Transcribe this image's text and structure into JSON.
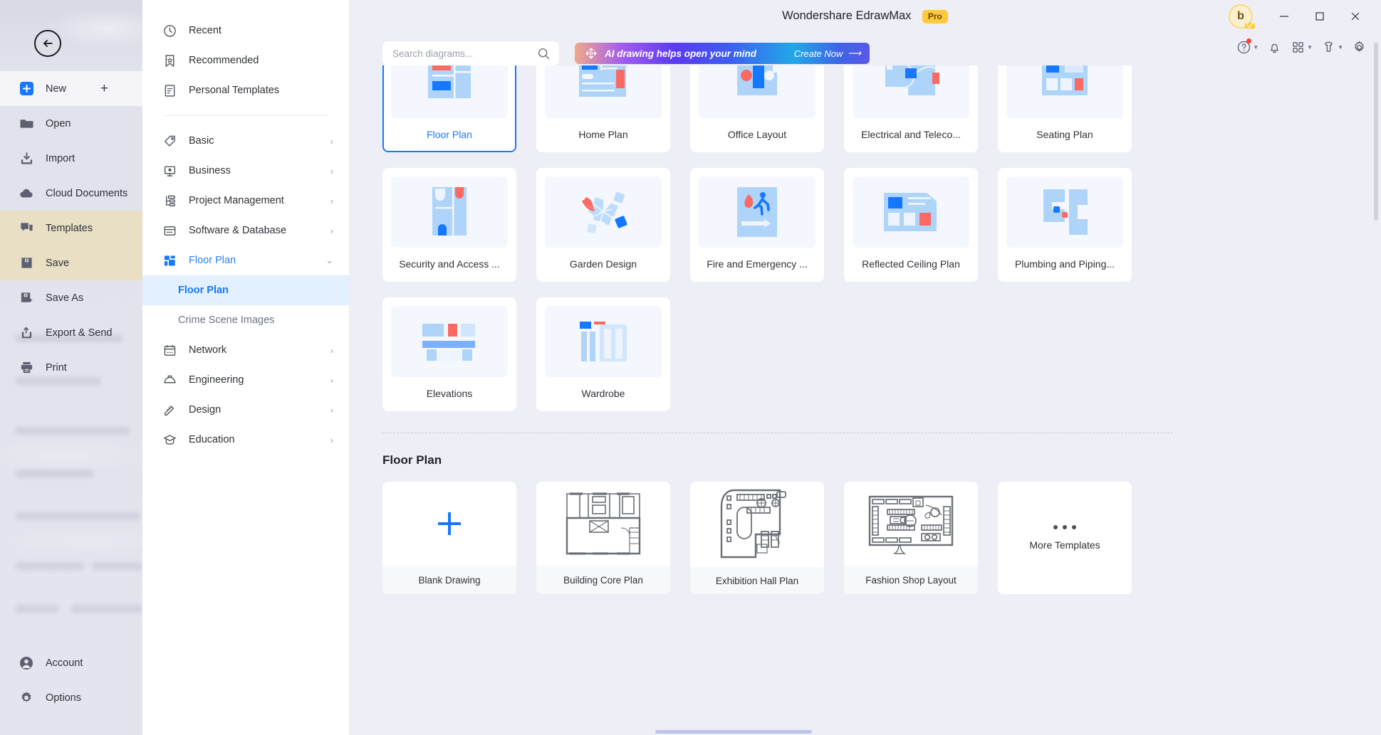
{
  "window": {
    "title": "Wondershare EdrawMax",
    "badge": "Pro",
    "avatar_initial": "b",
    "minimize": "minimize",
    "maximize": "maximize",
    "close": "close"
  },
  "toolbar_icons": [
    {
      "name": "help-icon",
      "label": "Help"
    },
    {
      "name": "bell-icon",
      "label": "Notifications"
    },
    {
      "name": "apps-icon",
      "label": "Apps"
    },
    {
      "name": "theme-icon",
      "label": "Theme"
    },
    {
      "name": "gear-icon",
      "label": "Settings"
    }
  ],
  "sidebar": {
    "back_label": "Back",
    "items": [
      {
        "label": "New",
        "icon": "new-icon",
        "state": "light",
        "trailing": "+"
      },
      {
        "label": "Open",
        "icon": "folder-icon",
        "state": "normal"
      },
      {
        "label": "Import",
        "icon": "import-icon",
        "state": "normal"
      },
      {
        "label": "Cloud Documents",
        "icon": "cloud-icon",
        "state": "normal"
      },
      {
        "label": "Templates",
        "icon": "templates-icon",
        "state": "highlight"
      },
      {
        "label": "Save",
        "icon": "save-icon",
        "state": "highlight"
      },
      {
        "label": "Save As",
        "icon": "save-as-icon",
        "state": "normal"
      },
      {
        "label": "Export & Send",
        "icon": "export-icon",
        "state": "normal"
      },
      {
        "label": "Print",
        "icon": "print-icon",
        "state": "normal"
      }
    ],
    "bottom_items": [
      {
        "label": "Account",
        "icon": "account-icon"
      },
      {
        "label": "Options",
        "icon": "options-gear-icon"
      }
    ]
  },
  "categories": {
    "top": [
      {
        "label": "Recent",
        "icon": "clock-icon"
      },
      {
        "label": "Recommended",
        "icon": "bookmark-star-icon"
      },
      {
        "label": "Personal Templates",
        "icon": "document-icon"
      }
    ],
    "list": [
      {
        "label": "Basic",
        "icon": "tag-icon",
        "chevron": "›",
        "active": false
      },
      {
        "label": "Business",
        "icon": "presentation-icon",
        "chevron": "›",
        "active": false
      },
      {
        "label": "Project Management",
        "icon": "project-icon",
        "chevron": "›",
        "active": false
      },
      {
        "label": "Software & Database",
        "icon": "database-icon",
        "chevron": "›",
        "active": false
      },
      {
        "label": "Floor Plan",
        "icon": "floorplan-icon",
        "chevron": "⌄",
        "active": true
      }
    ],
    "subitems": [
      {
        "label": "Floor Plan",
        "selected": true
      },
      {
        "label": "Crime Scene Images",
        "selected": false
      }
    ],
    "list_after": [
      {
        "label": "Network",
        "icon": "network-icon",
        "chevron": "›",
        "active": false
      },
      {
        "label": "Engineering",
        "icon": "helmet-icon",
        "chevron": "›",
        "active": false
      },
      {
        "label": "Design",
        "icon": "design-icon",
        "chevron": "›",
        "active": false
      },
      {
        "label": "Education",
        "icon": "education-icon",
        "chevron": "›",
        "active": false
      }
    ]
  },
  "search": {
    "placeholder": "Search diagrams...",
    "value": "",
    "icon": "search-icon"
  },
  "ai_banner": {
    "icon": "ai-sparkle-icon",
    "text": "AI drawing helps open your mind",
    "cta": "Create Now",
    "cta_arrow": "⟶"
  },
  "category_cards": [
    {
      "label": "Floor Plan",
      "thumb": "floor-plan",
      "selected": true
    },
    {
      "label": "Home Plan",
      "thumb": "home-plan",
      "selected": false
    },
    {
      "label": "Office Layout",
      "thumb": "office-layout",
      "selected": false
    },
    {
      "label": "Electrical and Teleco...",
      "thumb": "electrical",
      "selected": false
    },
    {
      "label": "Seating Plan",
      "thumb": "seating-plan",
      "selected": false
    },
    {
      "label": "Security and Access ...",
      "thumb": "security",
      "selected": false
    },
    {
      "label": "Garden Design",
      "thumb": "garden",
      "selected": false
    },
    {
      "label": "Fire and Emergency ...",
      "thumb": "fire",
      "selected": false
    },
    {
      "label": "Reflected Ceiling Plan",
      "thumb": "ceiling",
      "selected": false
    },
    {
      "label": "Plumbing and Piping...",
      "thumb": "plumbing",
      "selected": false
    },
    {
      "label": "Elevations",
      "thumb": "elevations",
      "selected": false
    },
    {
      "label": "Wardrobe",
      "thumb": "wardrobe",
      "selected": false
    }
  ],
  "section": {
    "title": "Floor Plan"
  },
  "templates": [
    {
      "label": "Blank Drawing",
      "thumb": "blank"
    },
    {
      "label": "Building Core Plan",
      "thumb": "building-core"
    },
    {
      "label": "Exhibition Hall Plan",
      "thumb": "exhibition-hall"
    },
    {
      "label": "Fashion Shop Layout",
      "thumb": "fashion-shop"
    },
    {
      "label": "More Templates",
      "thumb": "more"
    }
  ],
  "colors": {
    "accent": "#1677ff",
    "light_blue": "#aed4fa",
    "red": "#fa6a62",
    "badge_yellow": "#ffc93c",
    "sidebar_bg": "#e3e3ee",
    "main_bg": "#eeeef7"
  }
}
